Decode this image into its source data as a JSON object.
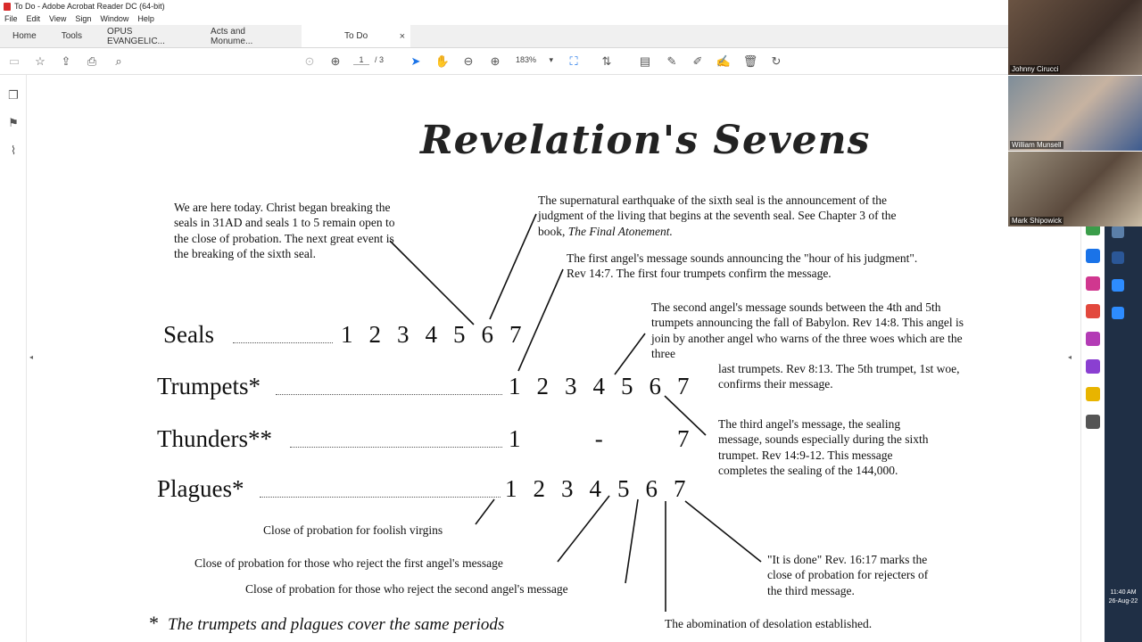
{
  "window": {
    "title": "To Do - Adobe Acrobat Reader DC (64-bit)"
  },
  "menu": [
    "File",
    "Edit",
    "View",
    "Sign",
    "Window",
    "Help"
  ],
  "tabs": {
    "home": "Home",
    "tools": "Tools",
    "doc1": "OPUS EVANGELIC...",
    "doc2": "Acts and Monume...",
    "active": "To Do"
  },
  "toolbar": {
    "page_current": "1",
    "page_total": "/ 3",
    "zoom": "183%"
  },
  "participants": [
    "Johnny Cirucci",
    "William Munsell",
    "Mark Shipowick"
  ],
  "clock": {
    "time": "11:40 AM",
    "date": "26-Aug-22"
  },
  "document": {
    "title": "Revelation's Sevens",
    "note_here": "We are here today. Christ began breaking the seals in 31AD and seals 1 to 5 remain open to the close of probation.  The next great event is the breaking of the sixth seal.",
    "note_sixth_seal": "The supernatural earthquake of the sixth seal is the announcement of the judgment of the living that begins at the seventh seal.  See Chapter 3 of the book,",
    "note_sixth_seal_book": "The Final Atonement.",
    "note_first_angel": "The first angel's message sounds announcing the \"hour of his judgment\".  Rev 14:7.  The first four trumpets confirm the message.",
    "note_second_angel": "The second angel's message sounds between the 4th and 5th trumpets announcing the fall of Babylon.  Rev 14:8. This angel is join by another angel who warns of the three woes which are the three",
    "note_second_angel_cont": "last trumpets.  Rev 8:13.  The 5th trumpet, 1st woe, confirms their message.",
    "note_third_angel": "The third angel's message, the sealing message, sounds especially during the sixth trumpet.  Rev 14:9-12.  This message completes the sealing of the 144,000.",
    "rows": {
      "seals": {
        "label": "Seals",
        "numbers": [
          "1",
          "2",
          "3",
          "4",
          "5",
          "6",
          "7"
        ]
      },
      "trumpets": {
        "label": "Trumpets*",
        "numbers": [
          "1",
          "2",
          "3",
          "4",
          "5",
          "6",
          "7"
        ]
      },
      "thunders": {
        "label": "Thunders**",
        "first": "1",
        "dash": "-",
        "last": "7"
      },
      "plagues": {
        "label": "Plagues*",
        "numbers": [
          "1",
          "2",
          "3",
          "4",
          "5",
          "6",
          "7"
        ]
      }
    },
    "close_foolish": "Close of probation for foolish virgins",
    "close_first": "Close of probation for those who reject the first angel's message",
    "close_second": "Close of probation for those who reject the second angel's message",
    "it_is_done": "\"It is done\" Rev. 16:17 marks the close of probation for rejecters of the third message.",
    "abomination": "The abomination of desolation established.",
    "footnote_star": "*",
    "footnote": "The trumpets and plagues cover the same periods"
  }
}
